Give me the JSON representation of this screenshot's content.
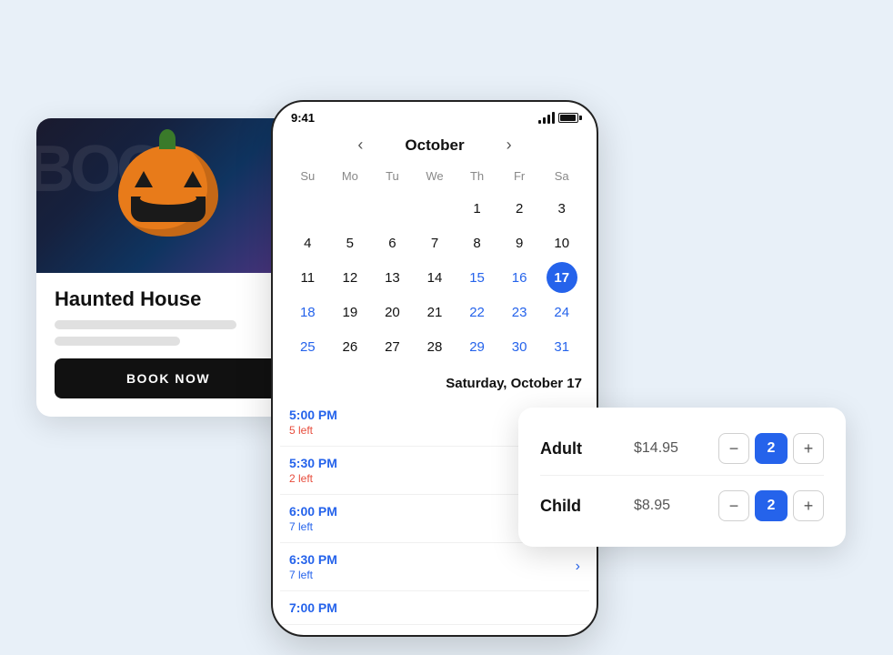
{
  "background_color": "#e8f0f8",
  "event_card": {
    "title": "Haunted House",
    "book_button": "BOOK NOW"
  },
  "phone": {
    "status_bar": {
      "time": "9:41"
    },
    "calendar": {
      "month": "October",
      "days_of_week": [
        "Su",
        "Mo",
        "Tu",
        "We",
        "Th",
        "Fr",
        "Sa"
      ],
      "weeks": [
        [
          "",
          "",
          "",
          "",
          "1",
          "2",
          "3"
        ],
        [
          "4",
          "5",
          "6",
          "7",
          "8",
          "9",
          "10"
        ],
        [
          "11",
          "12",
          "13",
          "14",
          "15",
          "16",
          "17"
        ],
        [
          "18",
          "19",
          "20",
          "21",
          "22",
          "23",
          "24"
        ],
        [
          "25",
          "26",
          "27",
          "28",
          "29",
          "30",
          "31"
        ]
      ],
      "blue_days": [
        "15",
        "16",
        "18",
        "22",
        "23",
        "24",
        "25",
        "29",
        "30",
        "31"
      ],
      "selected_day": "17"
    },
    "selected_date_label": "Saturday, October 17",
    "time_slots": [
      {
        "time": "5:00 PM",
        "availability": "5 left",
        "low": true,
        "has_chevron": false
      },
      {
        "time": "5:30 PM",
        "availability": "2 left",
        "low": true,
        "has_chevron": false
      },
      {
        "time": "6:00 PM",
        "availability": "7 left",
        "low": false,
        "has_chevron": true
      },
      {
        "time": "6:30 PM",
        "availability": "7 left",
        "low": false,
        "has_chevron": true
      },
      {
        "time": "7:00 PM",
        "availability": "",
        "low": false,
        "has_chevron": false
      }
    ]
  },
  "ticket_panel": {
    "adult": {
      "label": "Adult",
      "price": "$14.95",
      "quantity": 2
    },
    "child": {
      "label": "Child",
      "price": "$8.95",
      "quantity": 2
    },
    "minus_label": "−",
    "plus_label": "+"
  }
}
